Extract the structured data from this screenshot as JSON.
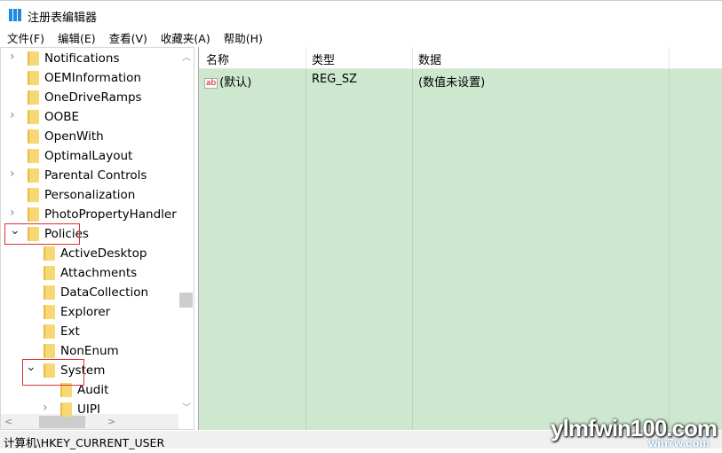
{
  "window": {
    "title": "注册表编辑器",
    "icon": "registry-icon"
  },
  "menu": [
    "文件(F)",
    "编辑(E)",
    "查看(V)",
    "收藏夹(A)",
    "帮助(H)"
  ],
  "tree": [
    {
      "label": "Notifications",
      "level": 1,
      "expander": "collapsed"
    },
    {
      "label": "OEMInformation",
      "level": 1,
      "expander": "none"
    },
    {
      "label": "OneDriveRamps",
      "level": 1,
      "expander": "none"
    },
    {
      "label": "OOBE",
      "level": 1,
      "expander": "collapsed"
    },
    {
      "label": "OpenWith",
      "level": 1,
      "expander": "none"
    },
    {
      "label": "OptimalLayout",
      "level": 1,
      "expander": "none"
    },
    {
      "label": "Parental Controls",
      "level": 1,
      "expander": "collapsed"
    },
    {
      "label": "Personalization",
      "level": 1,
      "expander": "none"
    },
    {
      "label": "PhotoPropertyHandler",
      "level": 1,
      "expander": "collapsed"
    },
    {
      "label": "Policies",
      "level": 1,
      "expander": "expanded",
      "highlighted": true
    },
    {
      "label": "ActiveDesktop",
      "level": 2,
      "expander": "none"
    },
    {
      "label": "Attachments",
      "level": 2,
      "expander": "none"
    },
    {
      "label": "DataCollection",
      "level": 2,
      "expander": "none"
    },
    {
      "label": "Explorer",
      "level": 2,
      "expander": "none"
    },
    {
      "label": "Ext",
      "level": 2,
      "expander": "none"
    },
    {
      "label": "NonEnum",
      "level": 2,
      "expander": "none"
    },
    {
      "label": "System",
      "level": 2,
      "expander": "expanded",
      "highlighted": true
    },
    {
      "label": "Audit",
      "level": 3,
      "expander": "none"
    },
    {
      "label": "UIPI",
      "level": 3,
      "expander": "collapsed"
    }
  ],
  "list": {
    "columns": [
      "名称",
      "类型",
      "数据"
    ],
    "rows": [
      {
        "name": "(默认)",
        "type": "REG_SZ",
        "data": "(数值未设置)",
        "icon": "string-value-icon"
      }
    ],
    "background": "#cde8cf"
  },
  "status": "计算机\\HKEY_CURRENT_USER",
  "watermark": {
    "main": "ylmfwin100.com",
    "sub": "win7w.com"
  }
}
